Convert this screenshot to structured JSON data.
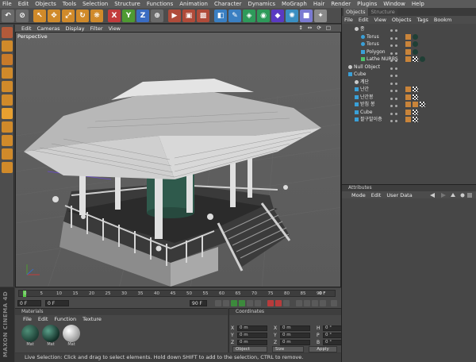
{
  "menubar": [
    "File",
    "Edit",
    "Objects",
    "Tools",
    "Selection",
    "Structure",
    "Functions",
    "Animation",
    "Character",
    "Dynamics",
    "MoGraph",
    "Hair",
    "Render",
    "Plugins",
    "Window",
    "Help"
  ],
  "toolbar": {
    "buttons": [
      {
        "name": "undo-icon",
        "glyph": "↶",
        "color": "#6a6a6a"
      },
      {
        "name": "redo-icon",
        "glyph": "⊘",
        "color": "#6a6a6a"
      },
      {
        "name": "live-selection-icon",
        "glyph": "↖",
        "color": "#d08a2a"
      },
      {
        "name": "move-icon",
        "glyph": "✥",
        "color": "#d08a2a"
      },
      {
        "name": "scale-icon",
        "glyph": "⤢",
        "color": "#d08a2a"
      },
      {
        "name": "rotate-icon",
        "glyph": "↻",
        "color": "#d08a2a"
      },
      {
        "name": "recent-tool-icon",
        "glyph": "❋",
        "color": "#d08a2a"
      },
      {
        "name": "x-axis-icon",
        "glyph": "X",
        "color": "#c23c3c"
      },
      {
        "name": "y-axis-icon",
        "glyph": "Y",
        "color": "#4e9a32"
      },
      {
        "name": "z-axis-icon",
        "glyph": "Z",
        "color": "#3a6cc2"
      },
      {
        "name": "coordinate-system-icon",
        "glyph": "⊕",
        "color": "#6a6a6a"
      },
      {
        "name": "render-view-icon",
        "glyph": "▶",
        "color": "#b04b3a"
      },
      {
        "name": "render-picture-viewer-icon",
        "glyph": "▣",
        "color": "#b04b3a"
      },
      {
        "name": "render-settings-icon",
        "glyph": "▩",
        "color": "#b04b3a"
      },
      {
        "name": "cube-primitive-icon",
        "glyph": "◧",
        "color": "#3a7fc2"
      },
      {
        "name": "pen-spline-icon",
        "glyph": "✎",
        "color": "#3a7fc2"
      },
      {
        "name": "subdivision-icon",
        "glyph": "◈",
        "color": "#2e9a5a"
      },
      {
        "name": "array-icon",
        "glyph": "◉",
        "color": "#2e9a5a"
      },
      {
        "name": "bend-deformer-icon",
        "glyph": "◆",
        "color": "#5a3ac2"
      },
      {
        "name": "environment-icon",
        "glyph": "✺",
        "color": "#3a8fc2"
      },
      {
        "name": "camera-icon",
        "glyph": "■",
        "color": "#7a7ad2"
      },
      {
        "name": "light-icon",
        "glyph": "✦",
        "color": "#8a8a8a"
      }
    ]
  },
  "viewport": {
    "menu": [
      "Edit",
      "Cameras",
      "Display",
      "Filter",
      "View"
    ],
    "label": "Perspective",
    "nav_icons": "↕ ↔ ⟳ □"
  },
  "timeline": {
    "ticks": [
      "0",
      "5",
      "10",
      "15",
      "20",
      "25",
      "30",
      "35",
      "40",
      "45",
      "50",
      "55",
      "60",
      "65",
      "70",
      "75",
      "80",
      "85",
      "90"
    ],
    "end_marker": "0 F"
  },
  "playback": {
    "current": "0 F",
    "start": "0 F",
    "end": "90 F"
  },
  "materials": {
    "title": "Materials",
    "menu": [
      "File",
      "Edit",
      "Function",
      "Texture"
    ],
    "items": [
      "Mat",
      "Mat",
      "Mat"
    ]
  },
  "coordinates": {
    "title": "Coordinates",
    "rows": [
      {
        "a": "X",
        "v1": "0 m",
        "b": "X",
        "v2": "0 m",
        "c": "H",
        "v3": "0 °"
      },
      {
        "a": "Y",
        "v1": "0 m",
        "b": "Y",
        "v2": "0 m",
        "c": "P",
        "v3": "0 °"
      },
      {
        "a": "Z",
        "v1": "0 m",
        "b": "Z",
        "v2": "0 m",
        "c": "B",
        "v3": "0 °"
      }
    ],
    "mode_select": "Object",
    "size_select": "Size",
    "apply": "Apply"
  },
  "status": "Live Selection: Click and drag to select elements. Hold down SHIFT to add to the selection, CTRL to remove.",
  "brand": "MAXON CINEMA 4D",
  "objects": {
    "tabs": [
      "Objects",
      "Structure"
    ],
    "menu": [
      "File",
      "Edit",
      "View",
      "Objects",
      "Tags",
      "Bookm"
    ],
    "rows": [
      {
        "name": "종",
        "indent": 1,
        "icon": "null",
        "tags": []
      },
      {
        "name": "Torus",
        "indent": 2,
        "icon": "torus",
        "tags": [
          "tex",
          "mat"
        ]
      },
      {
        "name": "Torus",
        "indent": 2,
        "icon": "torus",
        "tags": [
          "tex",
          "mat"
        ]
      },
      {
        "name": "Polygon",
        "indent": 2,
        "icon": "polygon",
        "tags": [
          "tex",
          "mat"
        ]
      },
      {
        "name": "Lathe NURBS",
        "indent": 2,
        "icon": "nurbs",
        "tags": [
          "tex",
          "check",
          "mat"
        ]
      },
      {
        "name": "Null Object",
        "indent": 0,
        "icon": "null",
        "tags": []
      },
      {
        "name": "Cube",
        "indent": 0,
        "icon": "cube",
        "tags": []
      },
      {
        "name": "계단",
        "indent": 1,
        "icon": "null",
        "tags": []
      },
      {
        "name": "난간",
        "indent": 1,
        "icon": "polygon",
        "tags": [
          "tex",
          "check"
        ]
      },
      {
        "name": "난간봉",
        "indent": 1,
        "icon": "polygon",
        "tags": [
          "tex",
          "check"
        ]
      },
      {
        "name": "받침 봉",
        "indent": 1,
        "icon": "polygon",
        "tags": [
          "tex",
          "tex",
          "check"
        ]
      },
      {
        "name": "Cube",
        "indent": 1,
        "icon": "cube",
        "tags": [
          "tex",
          "check"
        ]
      },
      {
        "name": "팔구발이층",
        "indent": 1,
        "icon": "polygon",
        "tags": [
          "tex",
          "check"
        ]
      }
    ]
  },
  "attributes": {
    "title": "Attributes",
    "menu": [
      "Mode",
      "Edit",
      "User Data"
    ]
  },
  "colors": {
    "accent_orange": "#d08a2a",
    "bell_green": "#2f5a4c",
    "select_green": "#5ccf4a"
  }
}
